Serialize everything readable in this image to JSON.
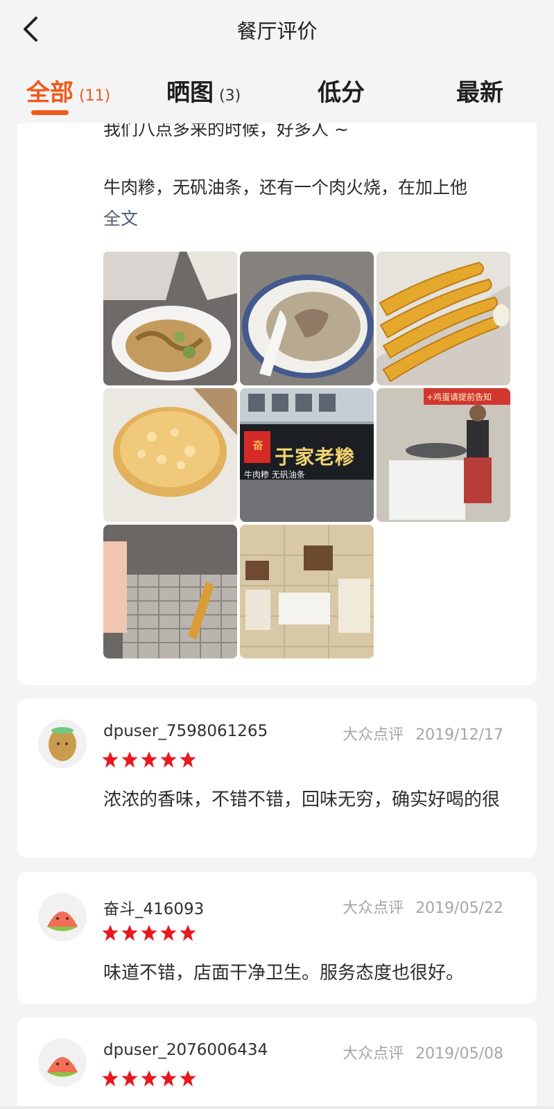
{
  "header": {
    "title": "餐厅评价"
  },
  "tabs": [
    {
      "label": "全部",
      "count": "(11)",
      "active": true
    },
    {
      "label": "晒图",
      "count": "(3)"
    },
    {
      "label": "低分",
      "count": ""
    },
    {
      "label": "最新",
      "count": ""
    }
  ],
  "first_review": {
    "line1": "我们八点多来的时候，好多人 ~",
    "line2": "牛肉糁，无矾油条，还有一个肉火烧，在加上他",
    "more": "全文",
    "photos": [
      {
        "subject": "pickled vegetables in bowl",
        "color": "#c8a36a"
      },
      {
        "subject": "beef soup in bowl",
        "color": "#b8ab92"
      },
      {
        "subject": "fried dough sticks",
        "color": "#e4ad2d"
      },
      {
        "subject": "baked meat pastry",
        "color": "#e3b862"
      },
      {
        "subject": "restaurant storefront",
        "color": "#5b6372",
        "sign_text": "于家老糁",
        "sign_sub": "牛肉糁 无矾油条",
        "badge": "奋"
      },
      {
        "subject": "kitchen staff",
        "color": "#c9c4b8",
        "sign_text": "+鸡蛋请提前告知"
      },
      {
        "subject": "frying basket",
        "color": "#7a7773"
      },
      {
        "subject": "wall certificates",
        "color": "#d8c8a6"
      }
    ]
  },
  "reviews": [
    {
      "username": "dpuser_7598061265",
      "source": "大众点评",
      "date": "2019/12/17",
      "rating": 5,
      "text": "浓浓的香味，不错不错，回味无穷，确实好喝的很",
      "avatar": "kiwi-icon"
    },
    {
      "username": "奋斗_416093",
      "source": "大众点评",
      "date": "2019/05/22",
      "rating": 5,
      "text": "味道不错，店面干净卫生。服务态度也很好。",
      "avatar": "watermelon-icon"
    },
    {
      "username": "dpuser_2076006434",
      "source": "大众点评",
      "date": "2019/05/08",
      "rating": 5,
      "text": "",
      "avatar": "watermelon-icon"
    }
  ],
  "colors": {
    "accent": "#ef5a1c",
    "star": "#e8181f"
  }
}
